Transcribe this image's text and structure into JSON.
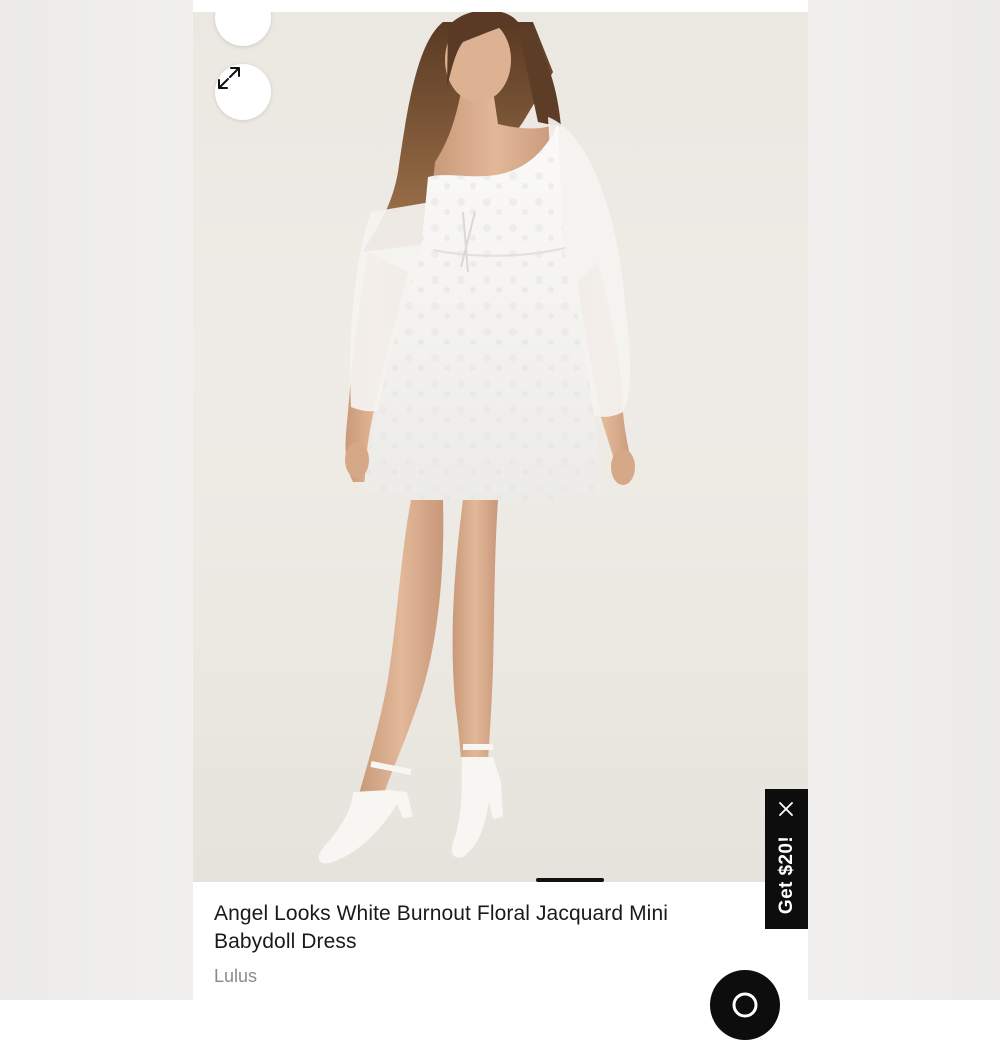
{
  "product": {
    "title": "Angel Looks White Burnout Floral Jacquard Mini Babydoll Dress",
    "brand": "Lulus",
    "image_alt": "Model wearing white floral jacquard mini babydoll dress with sheer long sleeves"
  },
  "gallery": {
    "collapse_icon": "chevron-down-icon",
    "expand_icon": "expand-arrows-icon"
  },
  "promo": {
    "label": "Get $20!",
    "close_icon": "close-icon"
  },
  "chat": {
    "icon": "search-chat-icon"
  },
  "colors": {
    "promo_bg": "#0d0d0d",
    "text_primary": "#1a1a1a",
    "text_secondary": "#8a8a8a",
    "photo_bg": "#ece8e2"
  }
}
